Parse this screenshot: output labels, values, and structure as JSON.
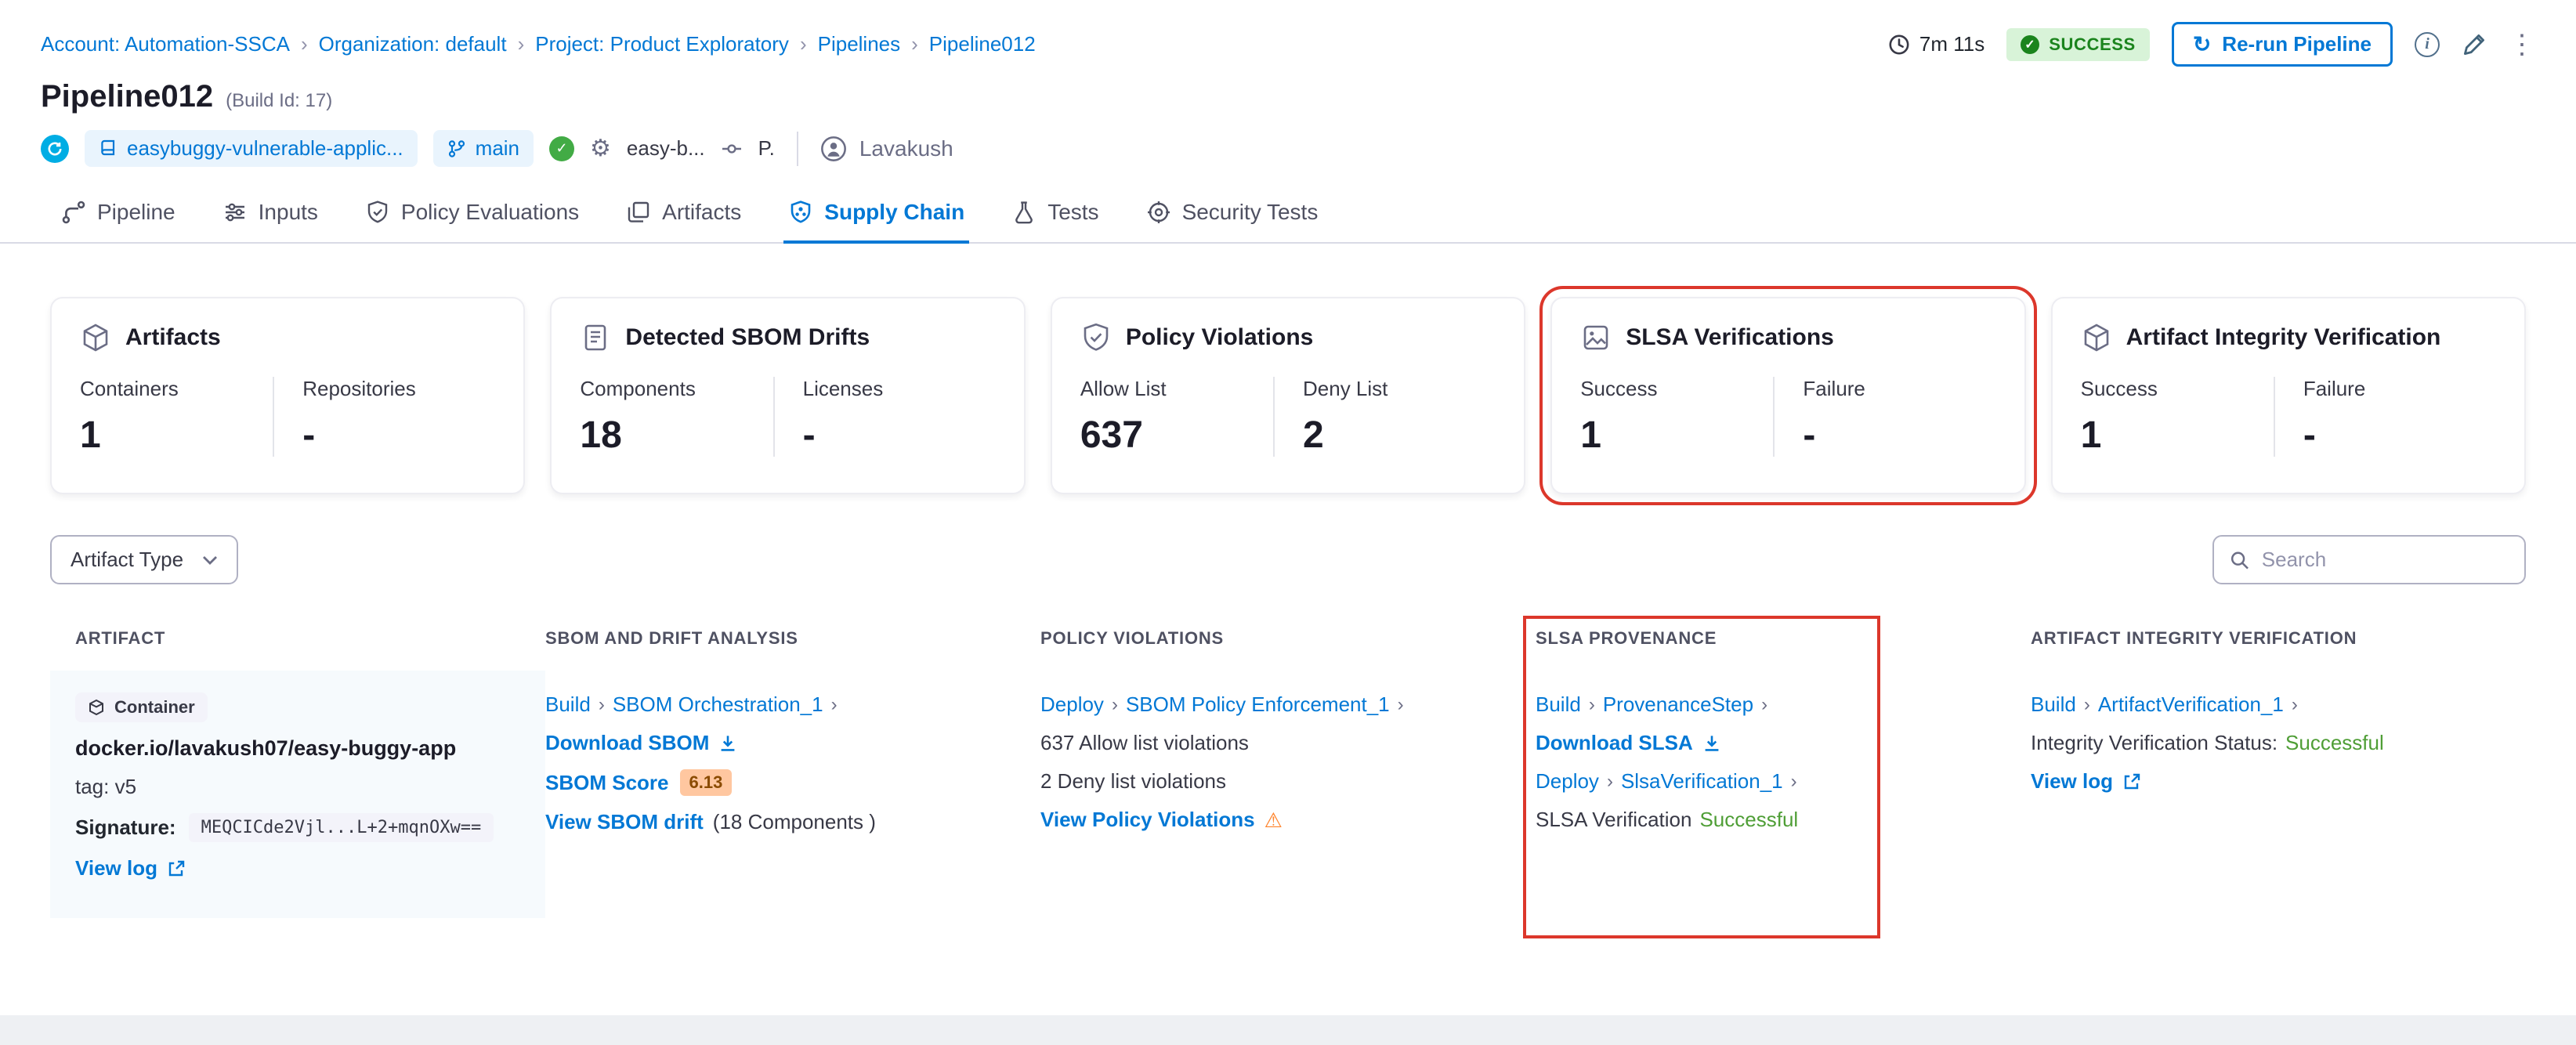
{
  "colors": {
    "accent": "#0278d5",
    "success_badge_bg": "#d8f3d8",
    "success_badge_text": "#1b841d",
    "success_text": "#4f9e36",
    "warning": "#ff832b",
    "annotation_red": "#dc372b",
    "score_badge_bg": "#ffc7a0"
  },
  "icons": {
    "chevron": "›",
    "gear": "⚙",
    "warning": "⚠",
    "kebab": "⋮",
    "check": "✓",
    "rerun": "↻",
    "info": "i"
  },
  "breadcrumb": {
    "items": [
      {
        "label": "Account: Automation-SSCA"
      },
      {
        "label": "Organization: default"
      },
      {
        "label": "Project: Product Exploratory"
      },
      {
        "label": "Pipelines"
      },
      {
        "label": "Pipeline012"
      }
    ]
  },
  "topbar": {
    "duration": "7m 11s",
    "status": "SUCCESS",
    "rerun_label": "Re-run Pipeline"
  },
  "header": {
    "title": "Pipeline012",
    "build_id": "(Build Id: 17)",
    "repo": "easybuggy-vulnerable-applic...",
    "branch": "main",
    "trigger_label": "easy-b...",
    "trigger_user_short": "P.",
    "user": "Lavakush"
  },
  "tabs": [
    {
      "label": "Pipeline"
    },
    {
      "label": "Inputs"
    },
    {
      "label": "Policy Evaluations"
    },
    {
      "label": "Artifacts"
    },
    {
      "label": "Supply Chain"
    },
    {
      "label": "Tests"
    },
    {
      "label": "Security Tests"
    }
  ],
  "cards": [
    {
      "title": "Artifacts",
      "metrics": [
        {
          "label": "Containers",
          "value": "1"
        },
        {
          "label": "Repositories",
          "value": "-"
        }
      ]
    },
    {
      "title": "Detected SBOM Drifts",
      "metrics": [
        {
          "label": "Components",
          "value": "18"
        },
        {
          "label": "Licenses",
          "value": "-"
        }
      ]
    },
    {
      "title": "Policy Violations",
      "metrics": [
        {
          "label": "Allow List",
          "value": "637"
        },
        {
          "label": "Deny List",
          "value": "2"
        }
      ]
    },
    {
      "title": "SLSA Verifications",
      "highlighted": true,
      "metrics": [
        {
          "label": "Success",
          "value": "1"
        },
        {
          "label": "Failure",
          "value": "-"
        }
      ]
    },
    {
      "title": "Artifact Integrity Verification",
      "metrics": [
        {
          "label": "Success",
          "value": "1"
        },
        {
          "label": "Failure",
          "value": "-"
        }
      ]
    }
  ],
  "filters": {
    "artifact_type": "Artifact Type",
    "search_placeholder": "Search"
  },
  "table": {
    "columns": [
      "ARTIFACT",
      "SBOM AND DRIFT ANALYSIS",
      "POLICY VIOLATIONS",
      "SLSA PROVENANCE",
      "ARTIFACT INTEGRITY VERIFICATION"
    ],
    "row": {
      "artifact": {
        "type_badge": "Container",
        "image": "docker.io/lavakush07/easy-buggy-app",
        "tag": "tag: v5",
        "signature_label": "Signature:",
        "signature_value": "MEQCICde2Vjl...L+2+mqnOXw==",
        "view_log": "View log"
      },
      "sbom": {
        "stage": "Build",
        "step": "SBOM Orchestration_1",
        "download": "Download SBOM",
        "score_label": "SBOM Score",
        "score": "6.13",
        "drift_link": "View SBOM drift",
        "drift_suffix": "(18 Components )"
      },
      "policy": {
        "stage": "Deploy",
        "step": "SBOM Policy Enforcement_1",
        "allow": "637 Allow list violations",
        "deny": "2 Deny list violations",
        "view": "View Policy Violations"
      },
      "slsa": {
        "stage1": "Build",
        "step1": "ProvenanceStep",
        "download": "Download SLSA",
        "stage2": "Deploy",
        "step2": "SlsaVerification_1",
        "status_label": "SLSA Verification",
        "status_value": "Successful"
      },
      "integrity": {
        "stage": "Build",
        "step": "ArtifactVerification_1",
        "status_label": "Integrity Verification Status:",
        "status_value": "Successful",
        "view_log": "View log"
      }
    }
  }
}
